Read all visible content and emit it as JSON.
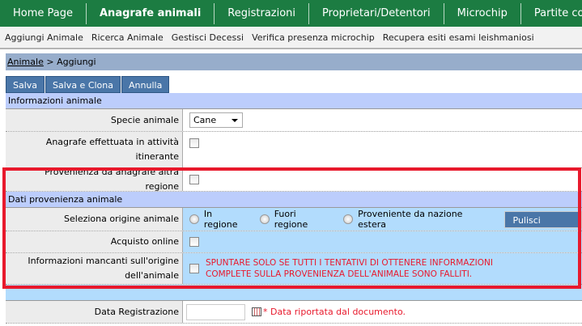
{
  "nav": [
    "Home Page",
    "Anagrafe animali",
    "Registrazioni",
    "Proprietari/Detentori",
    "Microchip",
    "Partite commerciali"
  ],
  "subnav": [
    "Aggiungi Animale",
    "Ricerca Animale",
    "Gestisci Decessi",
    "Verifica presenza microchip",
    "Recupera esiti esami leishmaniosi"
  ],
  "breadcrumb": {
    "link": "Animale",
    "sep": " > ",
    "current": "Aggiungi"
  },
  "buttons": {
    "save": "Salva",
    "save_clone": "Salva e Clona",
    "cancel": "Annulla"
  },
  "section1": {
    "title": "Informazioni animale",
    "species_label": "Specie animale",
    "species_value": "Cane",
    "itinerant_label": "Anagrafe effettuata in attività itinerante",
    "other_region_label": "Provenienza da anagrafe altra regione"
  },
  "section2": {
    "title": "Dati provenienza animale",
    "origin_label": "Seleziona origine animale",
    "origin_options": [
      "In regione",
      "Fuori regione",
      "Proveniente da nazione estera"
    ],
    "clear_button": "Pulisci campo",
    "online_label": "Acquisto online",
    "missing_label": "Informazioni mancanti sull'origine dell'animale",
    "warning": "SPUNTARE SOLO SE TUTTI I TENTATIVI DI OTTENERE INFORMAZIONI COMPLETE SULLA PROVENIENZA DELL'ANIMALE SONO FALLITI."
  },
  "registration": {
    "label": "Data Registrazione",
    "value": "",
    "note": "* Data riportata dal documento."
  }
}
